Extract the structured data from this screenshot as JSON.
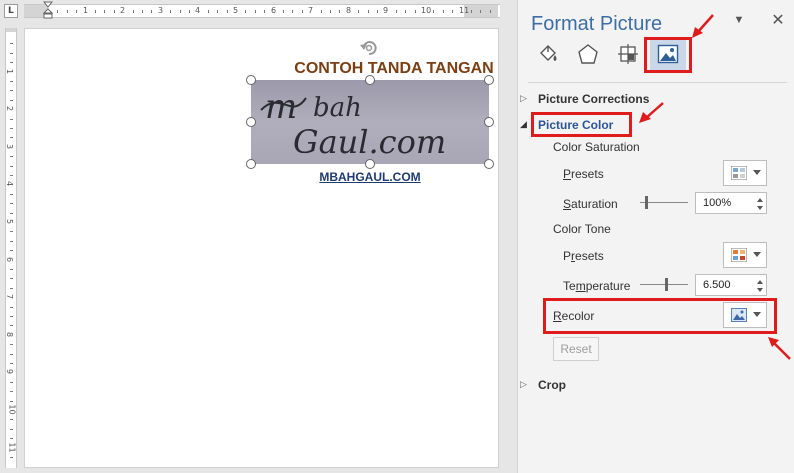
{
  "ruler": {
    "corner_glyph": "L",
    "h_numbers": [
      "1",
      "2",
      "3",
      "4",
      "5",
      "6",
      "7",
      "8",
      "9",
      "10",
      "11"
    ],
    "v_numbers": [
      "1",
      "2",
      "3",
      "4",
      "5",
      "6",
      "7",
      "8",
      "9",
      "10",
      "11"
    ]
  },
  "document": {
    "picture_title": "CONTOH TANDA TANGAN",
    "picture_caption": "MBAHGAUL.COM",
    "signature_text": "mbah Gaul.com"
  },
  "pane": {
    "title": "Format Picture",
    "menu_glyph": "▼",
    "close_glyph": "✕",
    "tabs": [
      {
        "name": "fill-line",
        "icon": "paint-bucket-icon"
      },
      {
        "name": "effects",
        "icon": "pentagon-icon"
      },
      {
        "name": "size-properties",
        "icon": "size-layout-icon"
      },
      {
        "name": "picture",
        "icon": "picture-icon"
      }
    ],
    "sections": {
      "picture_corrections": "Picture Corrections",
      "picture_color": "Picture Color",
      "crop": "Crop"
    },
    "color_saturation": {
      "heading": "Color Saturation",
      "presets_label": "Presets",
      "presets_accesskey": "P",
      "saturation_label": "Saturation",
      "saturation_accesskey": "S",
      "saturation_value": "100%",
      "saturation_level": 0.1
    },
    "color_tone": {
      "heading": "Color Tone",
      "presets_label": "Presets",
      "presets_accesskey": "r",
      "temperature_label": "Temperature",
      "temperature_accesskey": "m",
      "temperature_value": "6.500",
      "temperature_level": 0.55
    },
    "recolor": {
      "label": "Recolor",
      "accesskey": "R"
    },
    "reset_label": "Reset"
  },
  "colors": {
    "accent": "#2a5597",
    "callout": "#e01b1b",
    "title_brown": "#7b3f14"
  }
}
